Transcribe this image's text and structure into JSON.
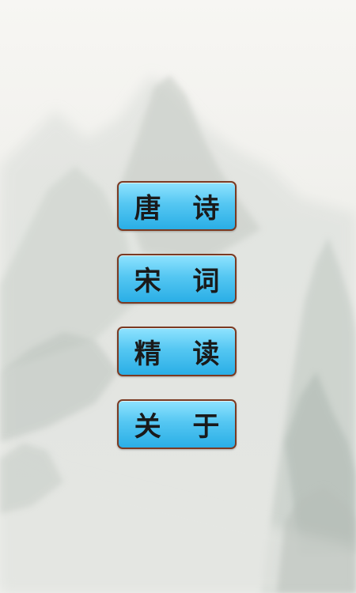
{
  "menu": {
    "items": [
      {
        "label": "唐 诗"
      },
      {
        "label": "宋 词"
      },
      {
        "label": "精 读"
      },
      {
        "label": "关 于"
      }
    ]
  },
  "colors": {
    "button_fill": "#55c7f2",
    "button_border": "#7b3a22",
    "label_text": "#1a1a1a",
    "background": "#f3f3f0"
  }
}
